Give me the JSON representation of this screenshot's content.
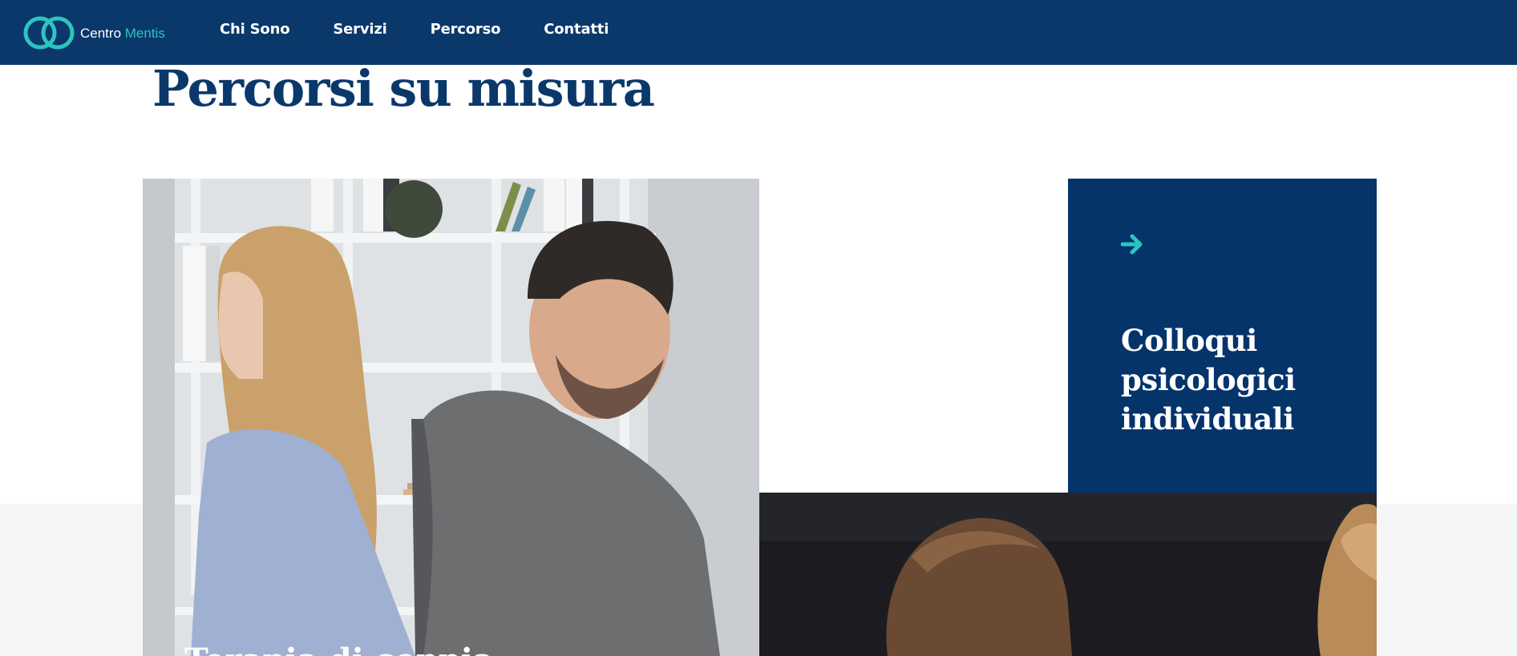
{
  "header": {
    "logo": {
      "word1": "Centro",
      "word2": "Mentis"
    },
    "nav": [
      {
        "label": "Chi Sono"
      },
      {
        "label": "Servizi"
      },
      {
        "label": "Percorso"
      },
      {
        "label": "Contatti"
      }
    ]
  },
  "main": {
    "title": "Percorsi su misura",
    "cards": [
      {
        "caption": "Terapia di coppia"
      },
      {
        "title": "Colloqui psicologici individuali",
        "icon": "arrow-right-icon"
      }
    ]
  },
  "colors": {
    "navy": "#0a386b",
    "card_navy": "#05346b",
    "teal": "#2cc4c0",
    "light_gray": "#f5f6f6"
  }
}
